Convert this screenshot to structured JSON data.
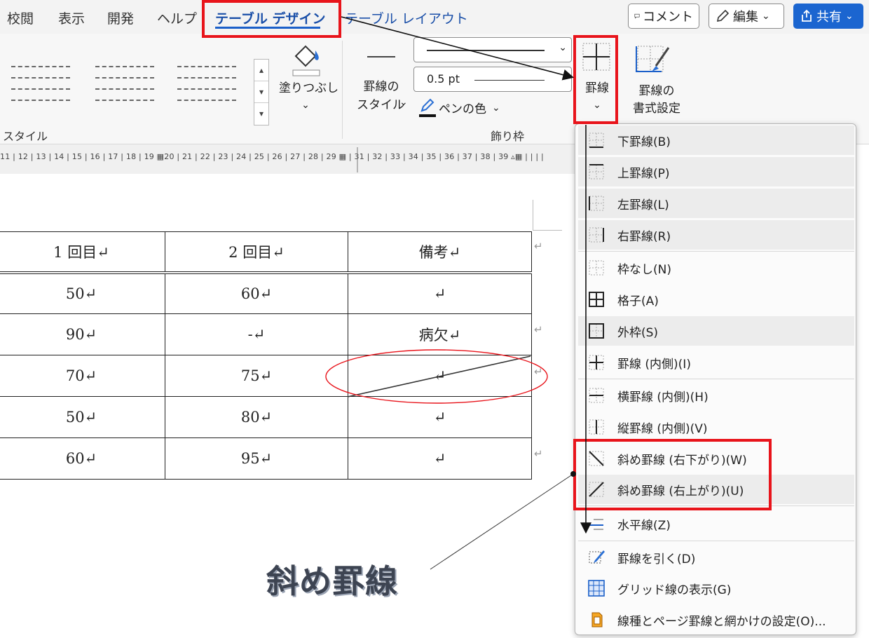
{
  "tabs": [
    {
      "label": "校閲",
      "active": false
    },
    {
      "label": "表示",
      "active": false
    },
    {
      "label": "開発",
      "active": false
    },
    {
      "label": "ヘルプ",
      "active": false
    },
    {
      "label": "テーブル デザイン",
      "active": true
    },
    {
      "label": "テーブル レイアウト",
      "active": false
    }
  ],
  "topbar": {
    "comment": "コメント",
    "edit": "編集",
    "share": "共有",
    "chevron": "⌄"
  },
  "ribbon": {
    "fill_label": "塗りつぶし",
    "border_style_label_1": "罫線の",
    "border_style_label_2": "スタイル",
    "line_weight": "0.5 pt",
    "pen_color": "ペンの色",
    "borders_label": "罫線",
    "border_painter_1": "罫線の",
    "border_painter_2": "書式設定",
    "group_styles": "スタイル",
    "group_borders": "飾り枠"
  },
  "ruler": "11 | 12 | 13 | 14 | 15 | 16 | 17 | 18 | 19 ▦20 | 21 | 22 | 23 | 24 | 25 | 26 | 27 | 28 | 29 ▦ | 31 | 32 | 33 | 34 | 35 | 36 | 37 | 38 | 39 ▵▦ | | | |",
  "table": {
    "headers": [
      "1 回目↵",
      "2 回目↵",
      "備考↵"
    ],
    "rows": [
      [
        "50↵",
        "60↵",
        "↵"
      ],
      [
        "90↵",
        "-↵",
        "病欠↵"
      ],
      [
        "70↵",
        "75↵",
        "↵"
      ],
      [
        "50↵",
        "80↵",
        "↵"
      ],
      [
        "60↵",
        "95↵",
        "↵"
      ]
    ],
    "row_end_mark": "↵"
  },
  "menu": {
    "items": [
      {
        "label": "下罫線(B)",
        "icon": "border-bottom-icon",
        "highlight": true
      },
      {
        "label": "上罫線(P)",
        "icon": "border-top-icon",
        "highlight": true
      },
      {
        "label": "左罫線(L)",
        "icon": "border-left-icon",
        "highlight": true
      },
      {
        "label": "右罫線(R)",
        "icon": "border-right-icon",
        "highlight": true
      },
      {
        "label": "枠なし(N)",
        "icon": "no-border-icon",
        "highlight": false
      },
      {
        "label": "格子(A)",
        "icon": "all-borders-icon",
        "highlight": false
      },
      {
        "label": "外枠(S)",
        "icon": "outside-borders-icon",
        "highlight": true
      },
      {
        "label": "罫線 (内側)(I)",
        "icon": "inside-borders-icon",
        "highlight": false
      },
      {
        "label": "横罫線 (内側)(H)",
        "icon": "inside-horizontal-icon",
        "highlight": false
      },
      {
        "label": "縦罫線 (内側)(V)",
        "icon": "inside-vertical-icon",
        "highlight": false
      },
      {
        "label": "斜め罫線 (右下がり)(W)",
        "icon": "diagonal-down-icon",
        "highlight": false
      },
      {
        "label": "斜め罫線 (右上がり)(U)",
        "icon": "diagonal-up-icon",
        "highlight": true
      },
      {
        "label": "水平線(Z)",
        "icon": "horizontal-line-icon",
        "highlight": false
      },
      {
        "label": "罫線を引く(D)",
        "icon": "draw-table-icon",
        "highlight": false
      },
      {
        "label": "グリッド線の表示(G)",
        "icon": "view-gridlines-icon",
        "highlight": false
      },
      {
        "label": "線種とページ罫線と網かけの設定(O)...",
        "icon": "borders-shading-icon",
        "highlight": false
      }
    ]
  },
  "annotation": {
    "label": "斜め罫線"
  },
  "colors": {
    "accent": "#1a5fc9",
    "annotation_red": "#e8141b",
    "share_button": "#1b65d0"
  }
}
